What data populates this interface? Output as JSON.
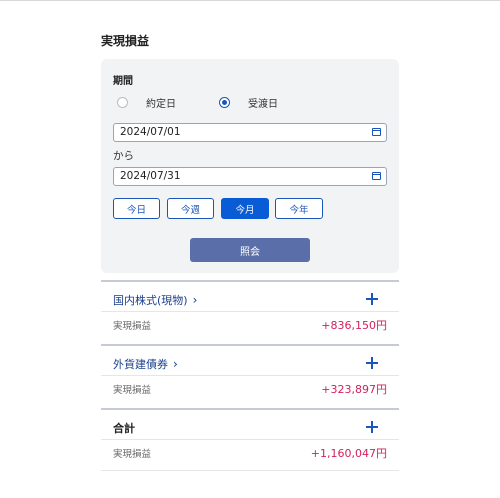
{
  "page": {
    "title": "実現損益"
  },
  "filter": {
    "period_label": "期間",
    "radio_options": [
      {
        "label": "約定日",
        "selected": false
      },
      {
        "label": "受渡日",
        "selected": true
      }
    ],
    "date_from": "2024/07/01",
    "from_label": "から",
    "date_to": "2024/07/31",
    "quick_buttons": [
      {
        "label": "今日",
        "active": false
      },
      {
        "label": "今週",
        "active": false
      },
      {
        "label": "今月",
        "active": true
      },
      {
        "label": "今年",
        "active": false
      }
    ],
    "submit_label": "照会"
  },
  "sections": [
    {
      "title": "国内株式(現物)",
      "chevron": "›",
      "label": "実現損益",
      "amount": "+836,150円"
    },
    {
      "title": "外貨建債券",
      "chevron": "›",
      "label": "実現損益",
      "amount": "+323,897円"
    },
    {
      "title": "合計",
      "chevron": "",
      "label": "実現損益",
      "amount": "+1,160,047円"
    }
  ],
  "colors": {
    "accent": "#1a56b8",
    "submit": "#5a6faa",
    "positive": "#d3215b"
  },
  "icons": {
    "calendar": "calendar-icon",
    "expand": "plus-icon",
    "chevron": "chevron-right-icon"
  }
}
